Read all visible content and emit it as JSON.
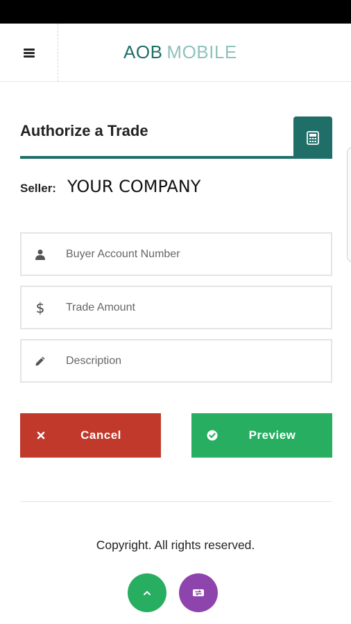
{
  "header": {
    "brand_primary": "AOB",
    "brand_secondary": "MOBILE",
    "menu_icon": "hamburger-menu-icon"
  },
  "colors": {
    "brand_teal": "#1f6e68",
    "brand_light": "#8fc2bc",
    "cancel_red": "#c0392b",
    "preview_green": "#27ae60",
    "swap_purple": "#8e44ad"
  },
  "panel": {
    "title": "Authorize a Trade",
    "calculator_icon": "calculator-icon"
  },
  "seller": {
    "label": "Seller:",
    "value": "YOUR COMPANY"
  },
  "form": {
    "buyer_account": {
      "placeholder": "Buyer Account Number",
      "value": "",
      "icon": "user-icon"
    },
    "trade_amount": {
      "placeholder": "Trade Amount",
      "value": "",
      "icon": "dollar-icon"
    },
    "description": {
      "placeholder": "Description",
      "value": "",
      "icon": "pencil-icon"
    }
  },
  "actions": {
    "cancel_label": "Cancel",
    "cancel_icon": "close-icon",
    "preview_label": "Preview",
    "preview_icon": "check-circle-icon"
  },
  "footer": {
    "copyright": "Copyright. All rights reserved.",
    "scroll_top_icon": "chevron-up-icon",
    "swap_icon": "swap-icon"
  }
}
